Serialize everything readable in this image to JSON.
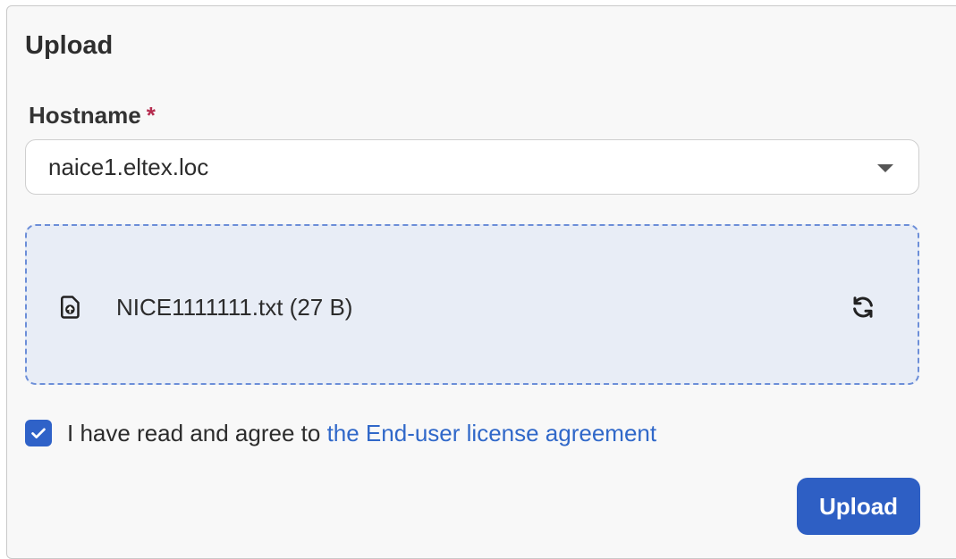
{
  "panel": {
    "title": "Upload"
  },
  "hostname": {
    "label": "Hostname",
    "required_mark": "*",
    "value": "naice1.eltex.loc"
  },
  "dropzone": {
    "file_name": "NICE1111111.txt (27 B)",
    "file_icon": "file-upload-icon",
    "replace_icon": "refresh-icon"
  },
  "agreement": {
    "checked": true,
    "text": "I have read and agree to",
    "link_text": "the End-user license agreement"
  },
  "actions": {
    "upload_label": "Upload"
  },
  "colors": {
    "accent": "#2e5fc4",
    "link": "#3068c9",
    "required": "#b52c4f",
    "dropzone_bg": "#e8edf6",
    "dropzone_border": "#6c8ed8"
  }
}
